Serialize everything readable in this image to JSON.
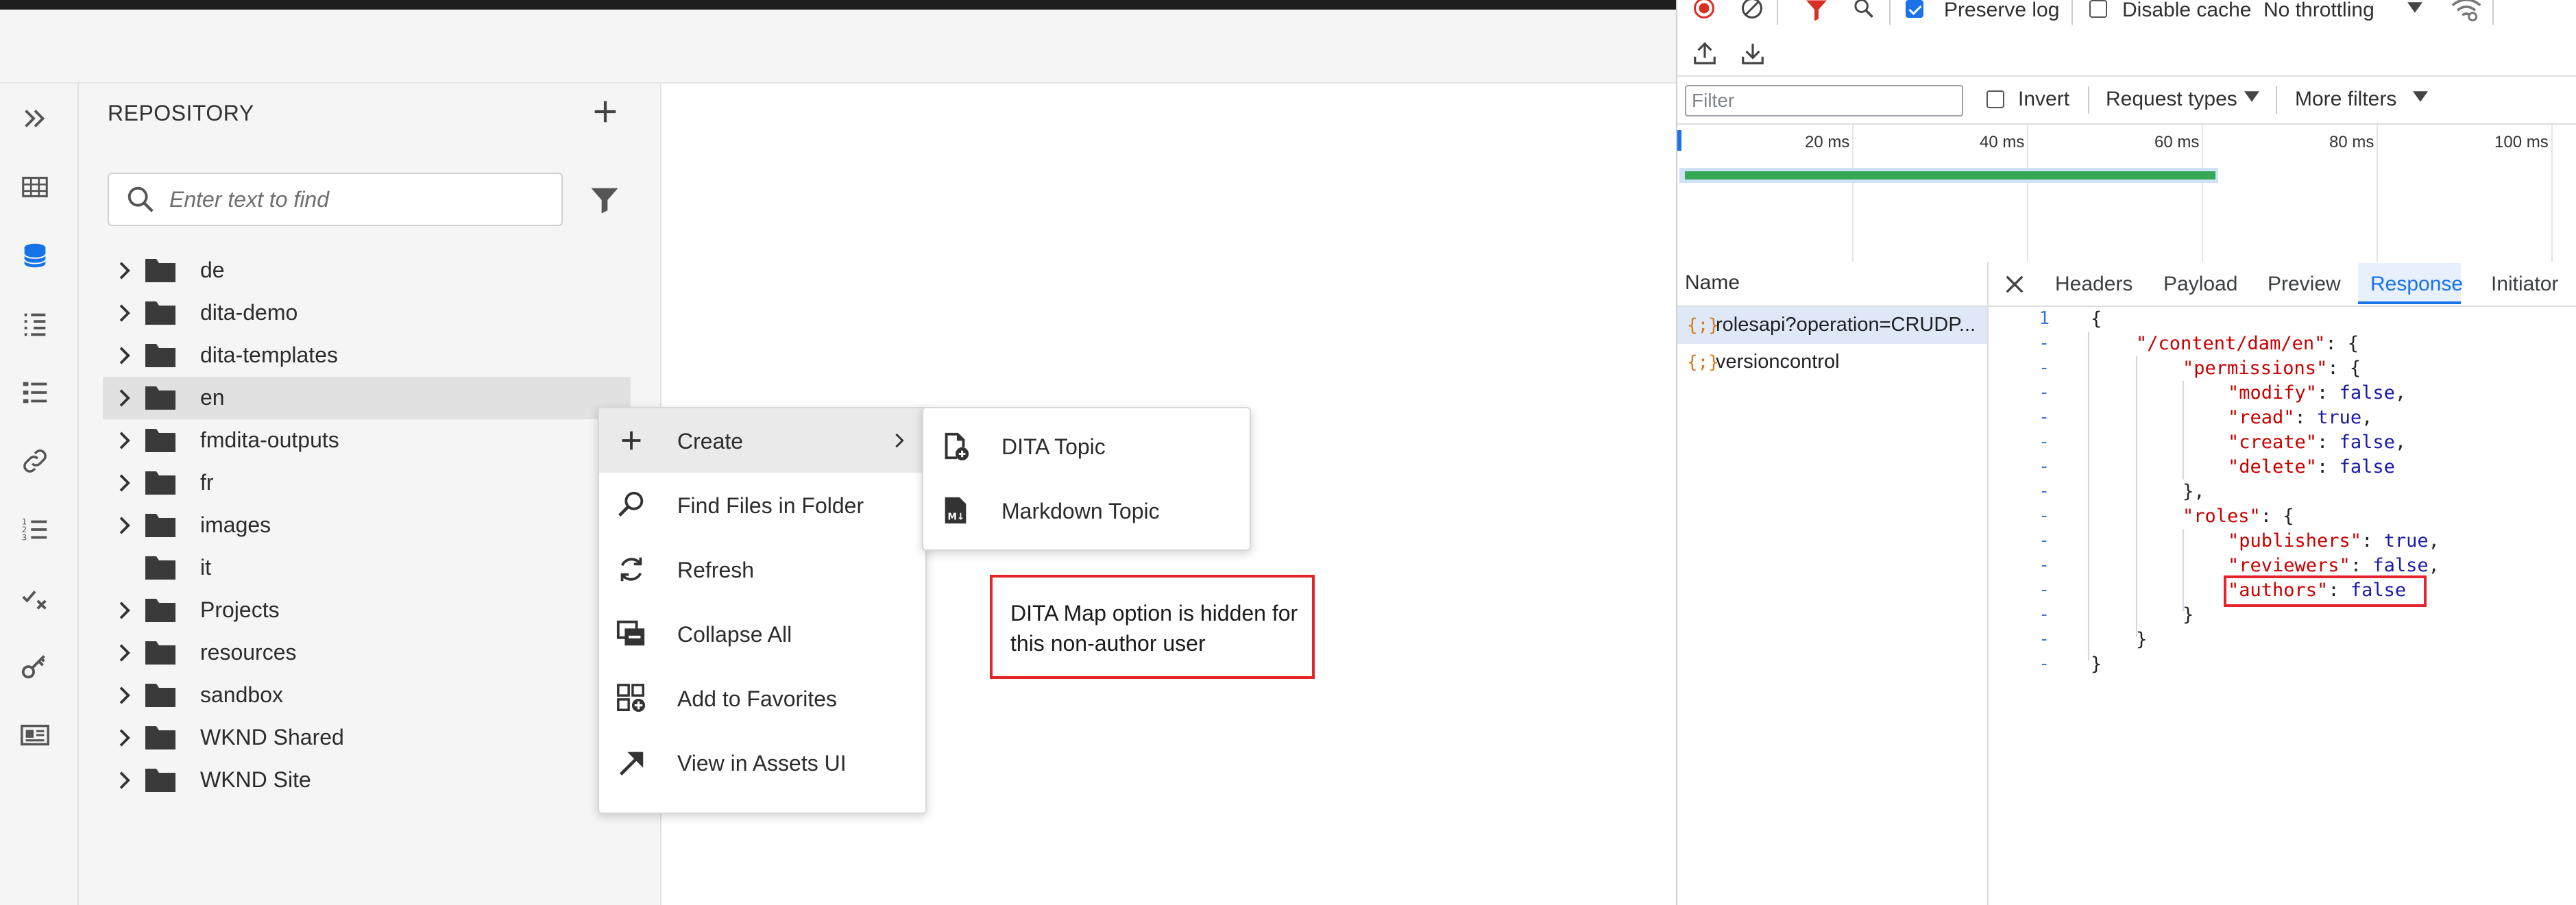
{
  "repository": {
    "title": "REPOSITORY",
    "search_placeholder": "Enter text to find",
    "tree": [
      {
        "label": "de",
        "expandable": true
      },
      {
        "label": "dita-demo",
        "expandable": true
      },
      {
        "label": "dita-templates",
        "expandable": true
      },
      {
        "label": "en",
        "expandable": true,
        "selected": true
      },
      {
        "label": "fmdita-outputs",
        "expandable": true
      },
      {
        "label": "fr",
        "expandable": true
      },
      {
        "label": "images",
        "expandable": true
      },
      {
        "label": "it",
        "expandable": false
      },
      {
        "label": "Projects",
        "expandable": true
      },
      {
        "label": "resources",
        "expandable": true
      },
      {
        "label": "sandbox",
        "expandable": true
      },
      {
        "label": "WKND Shared",
        "expandable": true
      },
      {
        "label": "WKND Site",
        "expandable": true
      }
    ]
  },
  "context_menu": {
    "items": [
      {
        "label": "Create",
        "icon": "plus-icon"
      },
      {
        "label": "Find Files in Folder",
        "icon": "search-icon"
      },
      {
        "label": "Refresh",
        "icon": "refresh-icon"
      },
      {
        "label": "Collapse All",
        "icon": "collapse-icon"
      },
      {
        "label": "Add to Favorites",
        "icon": "favorites-icon"
      },
      {
        "label": "View in Assets UI",
        "icon": "open-arrow-icon"
      }
    ],
    "submenu": [
      {
        "label": "DITA Topic",
        "icon": "dita-topic-icon"
      },
      {
        "label": "Markdown Topic",
        "icon": "markdown-icon"
      }
    ]
  },
  "callout": {
    "text": "DITA Map option is hidden for this non-author user"
  },
  "devtools": {
    "toolbar": {
      "preserve_log": "Preserve log",
      "disable_cache": "Disable cache",
      "throttling": "No throttling"
    },
    "filter_placeholder": "Filter",
    "invert": "Invert",
    "request_types": "Request types",
    "more_filters": "More filters",
    "timeline_ticks": [
      "20 ms",
      "40 ms",
      "60 ms",
      "80 ms",
      "100 ms"
    ],
    "name_header": "Name",
    "requests": [
      "rolesapi?operation=CRUDP...",
      "versioncontrol"
    ],
    "tabs": [
      "Headers",
      "Payload",
      "Preview",
      "Response",
      "Initiator"
    ],
    "active_tab": "Response",
    "line_number": "1",
    "response": {
      "path_key": "\"/content/dam/en\"",
      "permissions_key": "\"permissions\"",
      "modify_key": "\"modify\"",
      "modify_val": "false",
      "read_key": "\"read\"",
      "read_val": "true",
      "create_key": "\"create\"",
      "create_val": "false",
      "delete_key": "\"delete\"",
      "delete_val": "false",
      "roles_key": "\"roles\"",
      "publishers_key": "\"publishers\"",
      "publishers_val": "true",
      "reviewers_key": "\"reviewers\"",
      "reviewers_val": "false",
      "authors_key": "\"authors\"",
      "authors_val": "false"
    }
  }
}
